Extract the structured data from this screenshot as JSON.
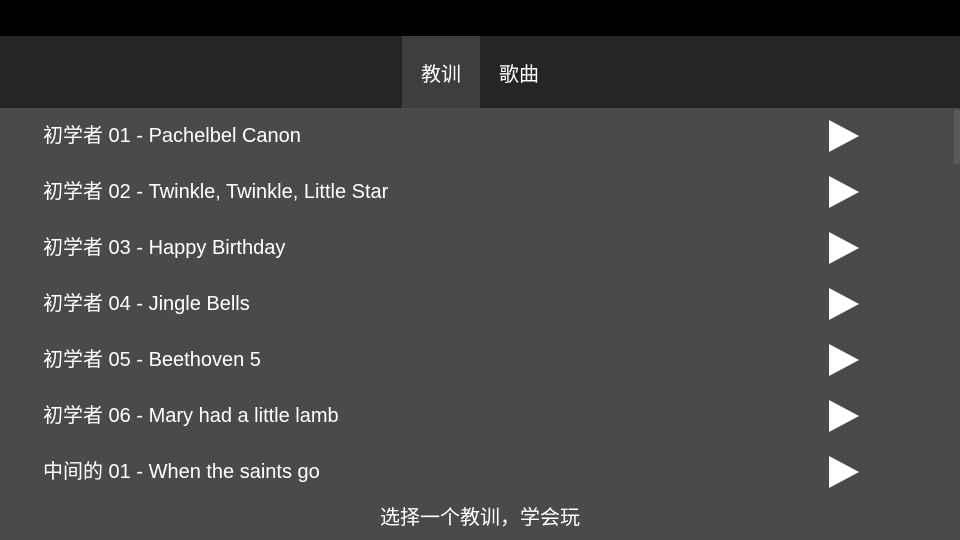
{
  "tabs": [
    {
      "label": "教训",
      "selected": true
    },
    {
      "label": "歌曲",
      "selected": false
    }
  ],
  "lessons": [
    {
      "title": "初学者 01 - Pachelbel Canon"
    },
    {
      "title": "初学者 02 - Twinkle, Twinkle, Little Star"
    },
    {
      "title": "初学者 03 - Happy Birthday"
    },
    {
      "title": "初学者 04 - Jingle Bells"
    },
    {
      "title": "初学者 05 - Beethoven 5"
    },
    {
      "title": "初学者 06 - Mary had a little lamb"
    },
    {
      "title": "中间的 01 - When the saints go"
    }
  ],
  "icons": {
    "row_action": "play-icon"
  },
  "scrollbar": {
    "position": 0
  },
  "footer": {
    "hint": "选择一个教训，学会玩"
  },
  "colors": {
    "status_bar": "#000000",
    "tab_bar": "#252525",
    "tab_selected": "#3e3e3e",
    "list_background": "#4a4a4a",
    "scrollbar_thumb": "#5a5a5a",
    "text": "#ffffff"
  }
}
